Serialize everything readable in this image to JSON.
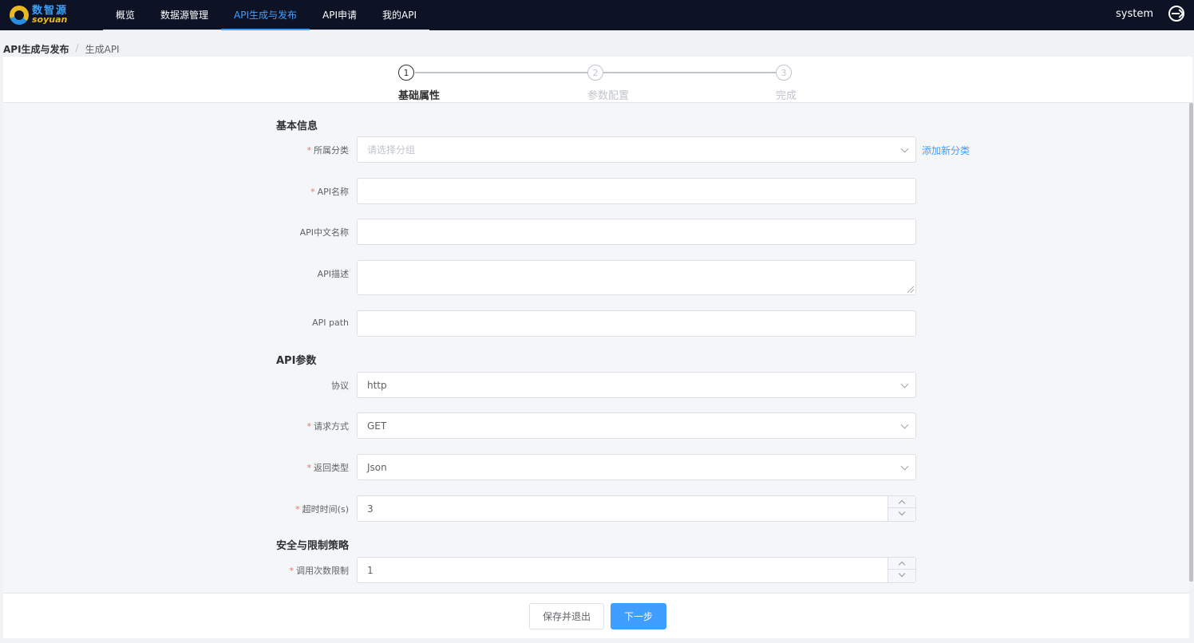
{
  "app": {
    "logo_cn": "数智源",
    "logo_en": "soyuan"
  },
  "nav": {
    "items": [
      {
        "label": "概览"
      },
      {
        "label": "数据源管理"
      },
      {
        "label": "API生成与发布"
      },
      {
        "label": "API申请"
      },
      {
        "label": "我的API"
      }
    ],
    "active_index": 2
  },
  "user": {
    "name": "system"
  },
  "breadcrumb": {
    "parent": "API生成与发布",
    "separator": "/",
    "current": "生成API"
  },
  "steps": {
    "items": [
      {
        "number": "1",
        "label": "基础属性"
      },
      {
        "number": "2",
        "label": "参数配置"
      },
      {
        "number": "3",
        "label": "完成"
      }
    ],
    "active_index": 0
  },
  "form": {
    "basic": {
      "title": "基本信息",
      "category": {
        "label": "所属分类",
        "placeholder": "请选择分组",
        "add_link": "添加新分类"
      },
      "name": {
        "label": "API名称",
        "value": ""
      },
      "cn_name": {
        "label": "API中文名称",
        "value": ""
      },
      "desc": {
        "label": "API描述",
        "value": ""
      },
      "path": {
        "label": "API path",
        "value": ""
      }
    },
    "params": {
      "title": "API参数",
      "protocol": {
        "label": "协议",
        "value": "http"
      },
      "method": {
        "label": "请求方式",
        "value": "GET"
      },
      "return_type": {
        "label": "返回类型",
        "value": "Json"
      },
      "timeout": {
        "label": "超时时间(s)",
        "value": "3"
      }
    },
    "security": {
      "title": "安全与限制策略",
      "call_limit": {
        "label": "调用次数限制",
        "value": "1"
      }
    }
  },
  "footer": {
    "save_exit_label": "保存并退出",
    "next_label": "下一步"
  },
  "colors": {
    "primary": "#409eff",
    "topbar": "#0d1325",
    "required": "#f56c6c"
  }
}
